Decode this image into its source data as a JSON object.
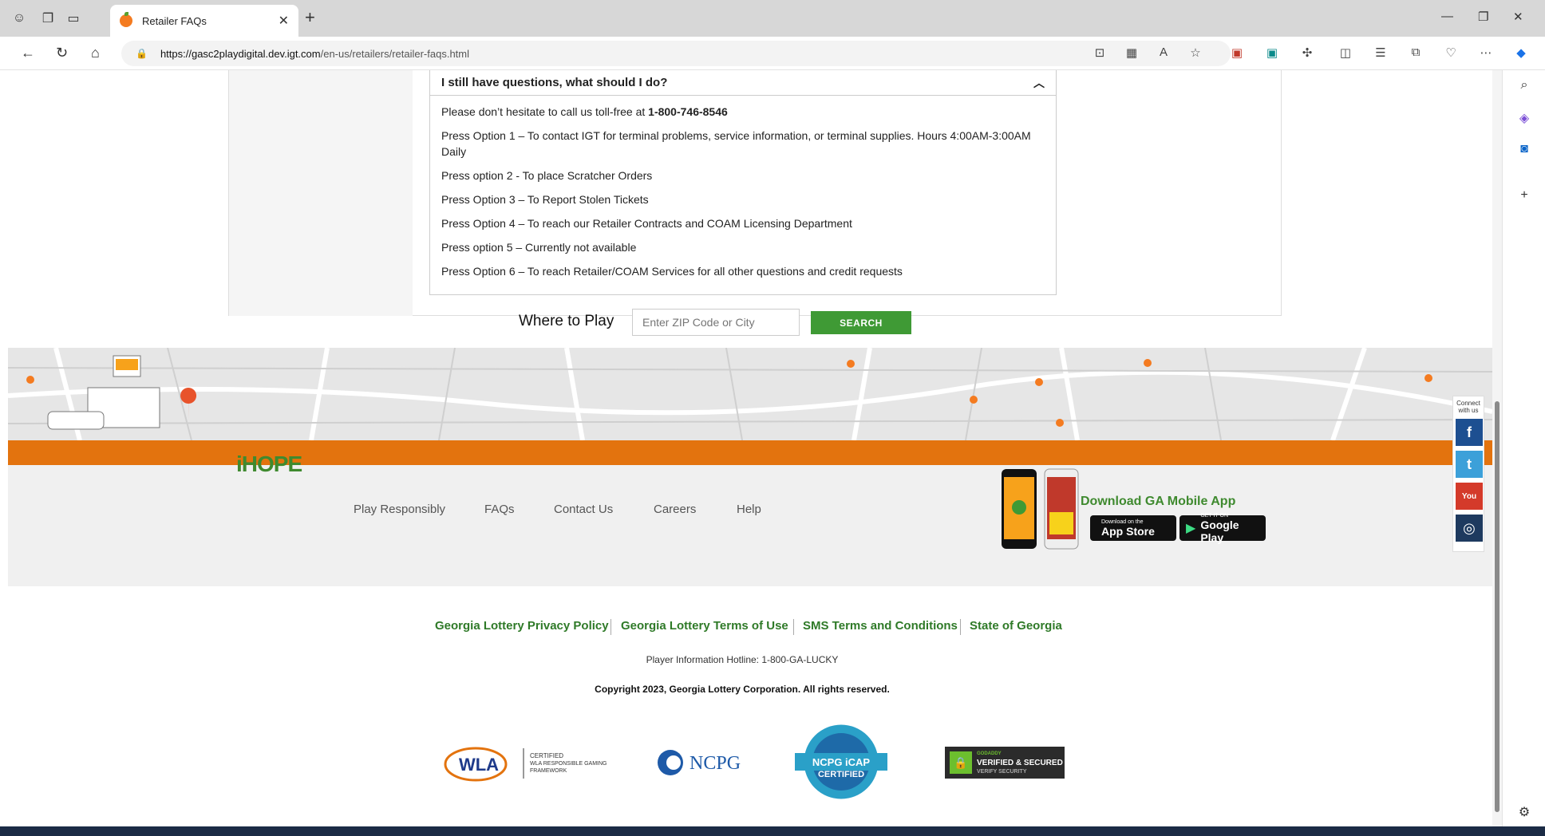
{
  "browser": {
    "tab_title": "Retailer FAQs",
    "url_host": "https://gasc2playdigital.dev.igt.com",
    "url_path": "/en-us/retailers/retailer-faqs.html"
  },
  "faq": {
    "question": "I still have questions, what should I do?",
    "intro": "Please don’t hesitate to call us toll-free at ",
    "phone": "1-800-746-8546",
    "lines": [
      "Press Option 1 – To contact IGT for terminal problems, service information, or terminal supplies. Hours 4:00AM-3:00AM Daily",
      "Press option 2 - To place Scratcher Orders",
      "Press Option 3 – To Report Stolen Tickets",
      "Press Option 4 – To reach our Retailer Contracts and COAM Licensing Department",
      "Press option 5 – Currently not available",
      "Press Option 6 – To reach Retailer/COAM Services for all other questions and credit requests"
    ]
  },
  "where_to_play": {
    "label": "Where to Play",
    "placeholder": "Enter ZIP Code or City",
    "button": "SEARCH"
  },
  "footer": {
    "logo": "iHOPE",
    "nav": [
      "Play Responsibly",
      "FAQs",
      "Contact Us",
      "Careers",
      "Help"
    ],
    "app_title": "Download GA Mobile App",
    "app_store_small": "Download on the",
    "app_store": "App Store",
    "google_small": "GET IT ON",
    "google": "Google Play",
    "connect": "Connect with us",
    "links": [
      "Georgia Lottery Privacy Policy",
      "Georgia Lottery Terms of Use",
      "SMS Terms and Conditions",
      "State of Georgia"
    ],
    "hotline": "Player Information Hotline: 1-800-GA-LUCKY",
    "copyright": "Copyright 2023, Georgia Lottery Corporation. All rights reserved.",
    "badges": {
      "wla": "WLA",
      "wla_text": "CERTIFIED\nWLA RESPONSIBLE GAMING\nFRAMEWORK",
      "ncpg": "NCPG",
      "icap": "NCPG iCAP CERTIFIED",
      "godaddy_top": "GODADDY",
      "godaddy": "VERIFIED & SECURED",
      "godaddy_sub": "VERIFY SECURITY"
    }
  },
  "colors": {
    "green": "#3f9a35",
    "orange": "#e3730e"
  }
}
